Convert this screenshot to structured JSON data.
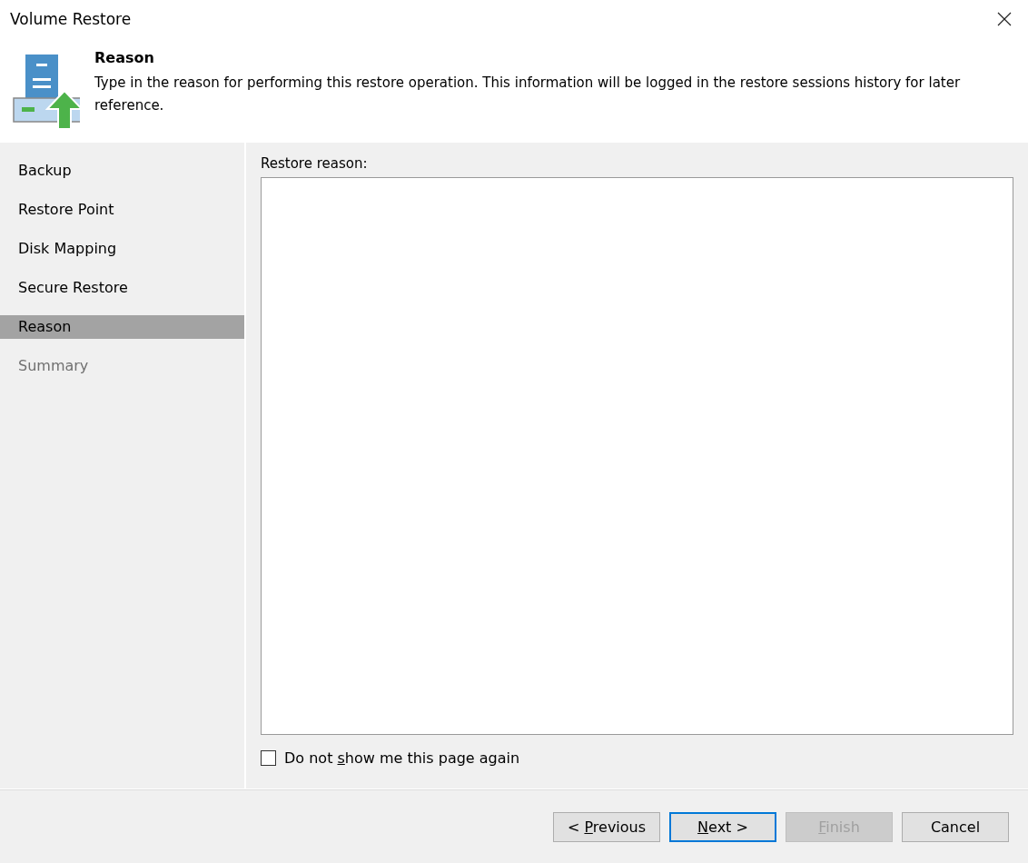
{
  "window": {
    "title": "Volume Restore"
  },
  "header": {
    "title": "Reason",
    "description": "Type in the reason for performing this restore operation. This information will be logged in the restore sessions history for later reference."
  },
  "steps": [
    {
      "label": "Backup",
      "selected": false,
      "disabled": false
    },
    {
      "label": "Restore Point",
      "selected": false,
      "disabled": false
    },
    {
      "label": "Disk Mapping",
      "selected": false,
      "disabled": false
    },
    {
      "label": "Secure Restore",
      "selected": false,
      "disabled": false
    },
    {
      "label": "Reason",
      "selected": true,
      "disabled": false
    },
    {
      "label": "Summary",
      "selected": false,
      "disabled": true
    }
  ],
  "reason_field": {
    "label": "Restore reason:"
  },
  "dont_show_checkbox": {
    "label_before": "Do not ",
    "access_key": "s",
    "label_after": "how me this page again",
    "checked": false
  },
  "buttons": [
    {
      "label_before": "< ",
      "access_key": "P",
      "label_after": "revious",
      "default": false,
      "disabled": false
    },
    {
      "access_key": "N",
      "label_after": "ext >",
      "default": true,
      "disabled": false
    },
    {
      "access_key": "F",
      "label_after": "inish",
      "default": false,
      "disabled": true
    },
    {
      "label_before": "Cancel",
      "default": false,
      "disabled": false
    }
  ]
}
